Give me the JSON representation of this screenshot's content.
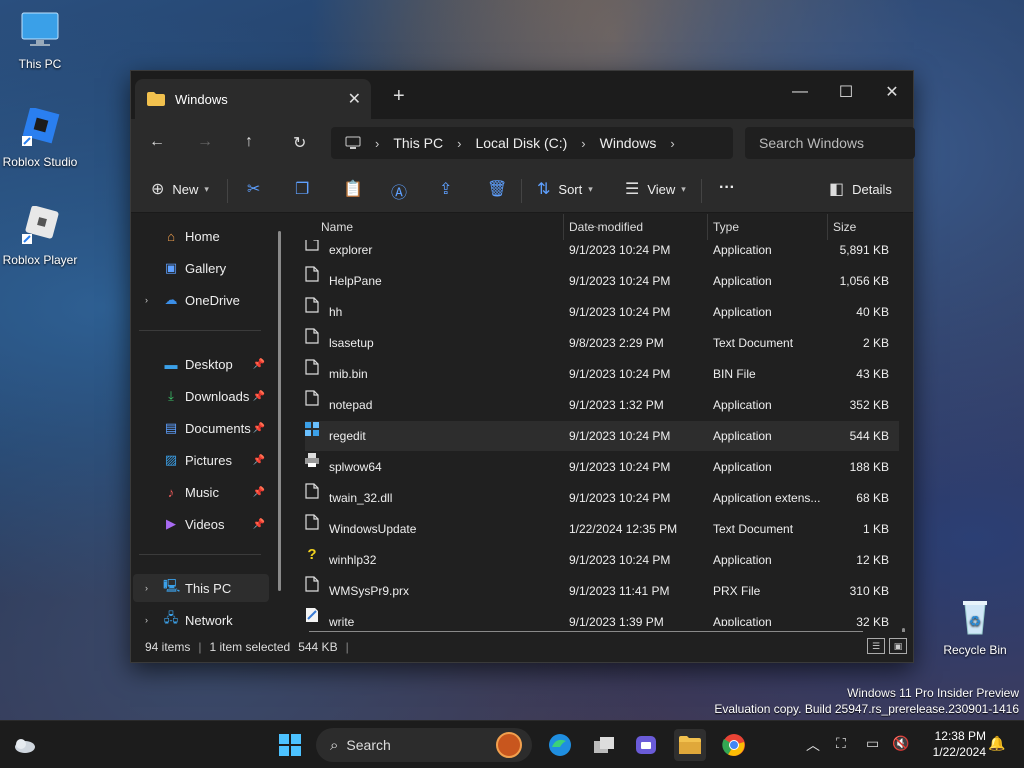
{
  "desktop": {
    "icons": [
      {
        "label": "This PC"
      },
      {
        "label": "Roblox Studio"
      },
      {
        "label": "Roblox Player"
      },
      {
        "label": "Recycle Bin"
      }
    ],
    "watermark_line1": "Windows 11 Pro Insider Preview",
    "watermark_line2": "Evaluation copy. Build 25947.rs_prerelease.230901-1416"
  },
  "window": {
    "tab_title": "Windows",
    "new_tab_symbol": "+",
    "breadcrumb": [
      "This PC",
      "Local Disk (C:)",
      "Windows"
    ],
    "search_placeholder": "Search Windows",
    "toolbar": {
      "new_label": "New",
      "sort_label": "Sort",
      "view_label": "View",
      "more_label": "···",
      "details_label": "Details"
    },
    "nav": {
      "items": [
        {
          "label": "Home"
        },
        {
          "label": "Gallery"
        },
        {
          "label": "OneDrive"
        },
        {
          "label": "Desktop"
        },
        {
          "label": "Downloads"
        },
        {
          "label": "Documents"
        },
        {
          "label": "Pictures"
        },
        {
          "label": "Music"
        },
        {
          "label": "Videos"
        },
        {
          "label": "This PC"
        },
        {
          "label": "Network"
        }
      ]
    },
    "columns": {
      "name": "Name",
      "date": "Date modified",
      "type": "Type",
      "size": "Size"
    },
    "files": [
      {
        "name": "explorer",
        "date": "9/1/2023 10:24 PM",
        "type": "Application",
        "size": "5,891 KB"
      },
      {
        "name": "HelpPane",
        "date": "9/1/2023 10:24 PM",
        "type": "Application",
        "size": "1,056 KB"
      },
      {
        "name": "hh",
        "date": "9/1/2023 10:24 PM",
        "type": "Application",
        "size": "40 KB"
      },
      {
        "name": "lsasetup",
        "date": "9/8/2023 2:29 PM",
        "type": "Text Document",
        "size": "2 KB"
      },
      {
        "name": "mib.bin",
        "date": "9/1/2023 10:24 PM",
        "type": "BIN File",
        "size": "43 KB"
      },
      {
        "name": "notepad",
        "date": "9/1/2023 1:32 PM",
        "type": "Application",
        "size": "352 KB"
      },
      {
        "name": "regedit",
        "date": "9/1/2023 10:24 PM",
        "type": "Application",
        "size": "544 KB"
      },
      {
        "name": "splwow64",
        "date": "9/1/2023 10:24 PM",
        "type": "Application",
        "size": "188 KB"
      },
      {
        "name": "twain_32.dll",
        "date": "9/1/2023 10:24 PM",
        "type": "Application extens...",
        "size": "68 KB"
      },
      {
        "name": "WindowsUpdate",
        "date": "1/22/2024 12:35 PM",
        "type": "Text Document",
        "size": "1 KB"
      },
      {
        "name": "winhlp32",
        "date": "9/1/2023 10:24 PM",
        "type": "Application",
        "size": "12 KB"
      },
      {
        "name": "WMSysPr9.prx",
        "date": "9/1/2023 11:41 PM",
        "type": "PRX File",
        "size": "310 KB"
      },
      {
        "name": "write",
        "date": "9/1/2023 1:39 PM",
        "type": "Application",
        "size": "32 KB"
      }
    ],
    "status": {
      "items": "94 items",
      "selected": "1 item selected",
      "selected_size": "544 KB"
    }
  },
  "taskbar": {
    "search_label": "Search",
    "time": "12:38 PM",
    "date": "1/22/2024"
  },
  "colors": {
    "accent": "#5ea0ff",
    "folder": "#f2c14e",
    "window_bg": "#202020"
  }
}
